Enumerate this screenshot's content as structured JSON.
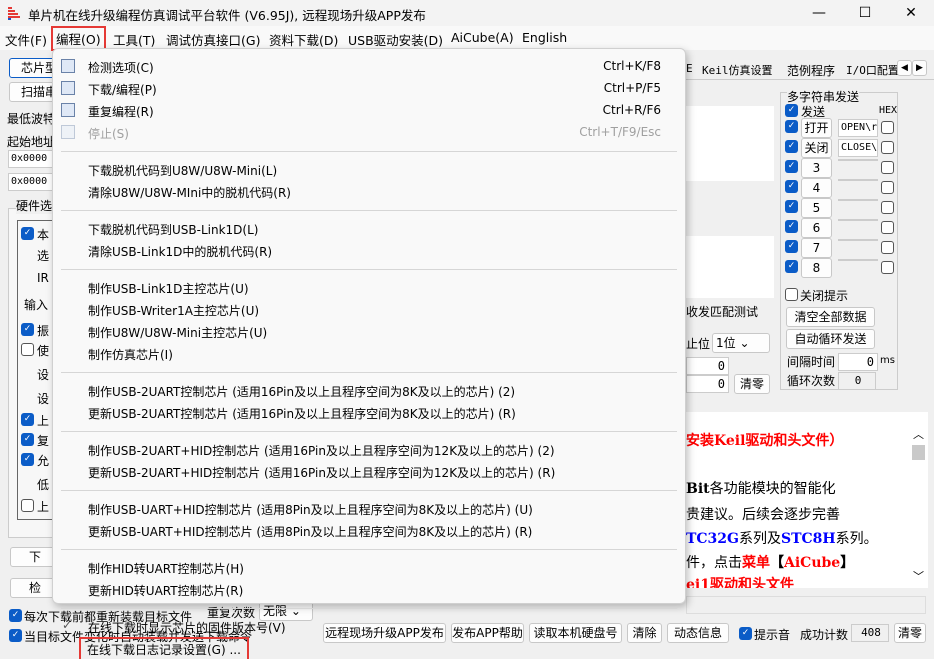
{
  "window": {
    "title": "单片机在线升级编程仿真调试平台软件 (V6.95J), 远程现场升级APP发布",
    "min": "—",
    "max": "☐",
    "close": "✕"
  },
  "menubar": [
    "文件(F)",
    "编程(O)",
    "工具(T)",
    "调试仿真接口(G)",
    "资料下载(D)",
    "USB驱动安装(D)",
    "AiCube(A)",
    "English"
  ],
  "menu": {
    "groups": [
      [
        {
          "label": "检测选项(C)",
          "shortcut": "Ctrl+K/F8",
          "icon": "detect-icon"
        },
        {
          "label": "下载/编程(P)",
          "shortcut": "Ctrl+P/F5",
          "icon": "download-icon"
        },
        {
          "label": "重复编程(R)",
          "shortcut": "Ctrl+R/F6",
          "icon": "repeat-icon"
        },
        {
          "label": "停止(S)",
          "shortcut": "Ctrl+T/F9/Esc",
          "icon": "stop-icon",
          "disabled": true
        }
      ],
      [
        {
          "label": "下载脱机代码到U8W/U8W-Mini(L)"
        },
        {
          "label": "清除U8W/U8W-MIni中的脱机代码(R)"
        }
      ],
      [
        {
          "label": "下载脱机代码到USB-Link1D(L)"
        },
        {
          "label": "清除USB-Link1D中的脱机代码(R)"
        }
      ],
      [
        {
          "label": "制作USB-Link1D主控芯片(U)"
        },
        {
          "label": "制作USB-Writer1A主控芯片(U)"
        },
        {
          "label": "制作U8W/U8W-Mini主控芯片(U)"
        },
        {
          "label": "制作仿真芯片(I)"
        }
      ],
      [
        {
          "label": "制作USB-2UART控制芯片 (适用16Pin及以上且程序空间为8K及以上的芯片) (2)"
        },
        {
          "label": "更新USB-2UART控制芯片 (适用16Pin及以上且程序空间为8K及以上的芯片) (R)"
        }
      ],
      [
        {
          "label": "制作USB-2UART+HID控制芯片 (适用16Pin及以上且程序空间为12K及以上的芯片) (2)"
        },
        {
          "label": "更新USB-2UART+HID控制芯片 (适用16Pin及以上且程序空间为12K及以上的芯片) (R)"
        }
      ],
      [
        {
          "label": "制作USB-UART+HID控制芯片 (适用8Pin及以上且程序空间为8K及以上的芯片) (U)"
        },
        {
          "label": "更新USB-UART+HID控制芯片 (适用8Pin及以上且程序空间为8K及以上的芯片) (R)"
        }
      ],
      [
        {
          "label": "制作HID转UART控制芯片(H)"
        },
        {
          "label": "更新HID转UART控制芯片(R)"
        }
      ],
      [
        {
          "label": "在线下载时显示芯片的固件版本号(V)",
          "checked": true
        },
        {
          "label": "在线下载日志记录设置(G) ...",
          "highlight": true
        }
      ]
    ]
  },
  "left": {
    "chip_type": "芯片型",
    "scan": "扫描串",
    "min_baud": "最低波特",
    "start_addr": "起始地址",
    "addr1": "0x0000",
    "addr2": "0x0000",
    "hw_tab": "硬件选",
    "hw": [
      "本",
      "选",
      "IR",
      "输入",
      "振",
      "使",
      "设",
      "设",
      "上",
      "复",
      "允",
      "低",
      "上"
    ],
    "download_btn": "下",
    "check_btn": "检",
    "reload": "每次下载前都重新装载目标文件",
    "auto_load": "当目标文件变化时自动装载并发送下载命令",
    "repeat_label": "重复次数",
    "repeat_value": "无限"
  },
  "tabs": [
    "E",
    "Keil仿真设置",
    "范例程序",
    "I/O口配置"
  ],
  "multi": {
    "title": "多字符串发送",
    "send": "发送",
    "hex": "HEX",
    "rows": [
      {
        "btn": "打开",
        "value": "OPEN\\r"
      },
      {
        "btn": "关闭",
        "value": "CLOSE\\"
      },
      {
        "btn": "3",
        "value": ""
      },
      {
        "btn": "4",
        "value": ""
      },
      {
        "btn": "5",
        "value": ""
      },
      {
        "btn": "6",
        "value": ""
      },
      {
        "btn": "7",
        "value": ""
      },
      {
        "btn": "8",
        "value": ""
      }
    ],
    "close_tip": "关闭提示",
    "clear_all": "清空全部数据",
    "auto_loop": "自动循环发送",
    "interval_label": "间隔时间",
    "interval": "0",
    "ms": "ms",
    "loop_label": "循环次数",
    "loop": "0"
  },
  "serial": {
    "match_test": "收发匹配测试",
    "stop_label": "止位",
    "stop_value": "1位",
    "rx": "0",
    "tx": "0",
    "clear": "清零"
  },
  "log": {
    "l1": "安装Keil驱动和头文件）",
    "l2a": "Bit",
    "l2b": "各功能模块的智能化",
    "l3": "贵建议。后续会逐步完善",
    "l4a": "TC32G",
    "l4b": "系列及",
    "l4c": "STC8H",
    "l4d": "系列。",
    "l5a": "件，点击",
    "l5b": "菜单",
    "l5c": "【",
    "l5d": "AiCube",
    "l5e": "】",
    "l6": "ei1驱动和头文件"
  },
  "bottom": {
    "remote": "远程现场升级APP发布",
    "help": "发布APP帮助",
    "disk": "读取本机硬盘号",
    "clear": "清除",
    "dynamic": "动态信息",
    "beep": "提示音",
    "success_label": "成功计数",
    "success": "408",
    "reset": "清零"
  }
}
